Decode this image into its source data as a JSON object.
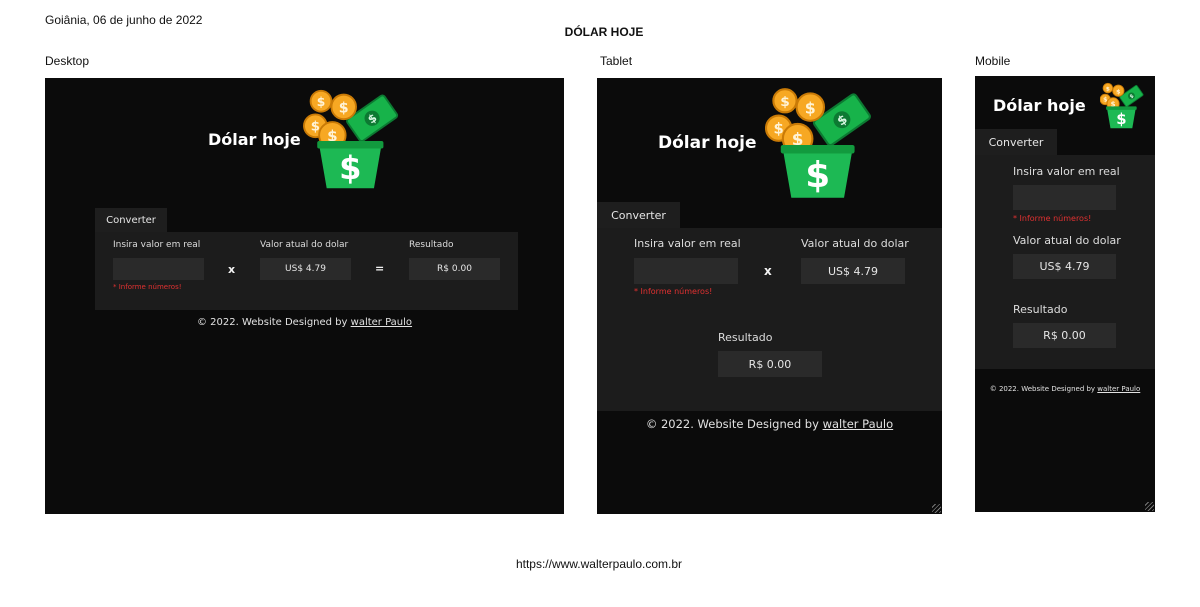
{
  "document": {
    "date": "Goiânia, 06 de junho de 2022",
    "title": "DÓLAR HOJE",
    "url": "https://www.walterpaulo.com.br"
  },
  "frames": {
    "desktop": "Desktop",
    "tablet": "Tablet",
    "mobile": "Mobile"
  },
  "app": {
    "brand": "Dólar hoje",
    "mobile_brand": "Dólar hoje",
    "tab": "Converter",
    "input_label": "Insira valor em real",
    "input_value": "",
    "error": "* Informe números!",
    "rate_label": "Valor atual do dolar",
    "rate_value": "US$ 4.79",
    "result_label": "Resultado",
    "result_value": "R$ 0.00",
    "times": "x",
    "equals": "=",
    "footer_text": "© 2022. Website Designed by ",
    "footer_link": "walter Paulo"
  },
  "colors": {
    "background": "#0b0b0b",
    "panel": "#1c1c1c",
    "field": "#2a2a2a",
    "error": "#e03131",
    "coin": "#f7a823",
    "bill": "#17b34a",
    "bucket": "#1db954"
  },
  "icons": [
    "dollar-bucket-logo",
    "coin-icon",
    "bill-icon"
  ]
}
